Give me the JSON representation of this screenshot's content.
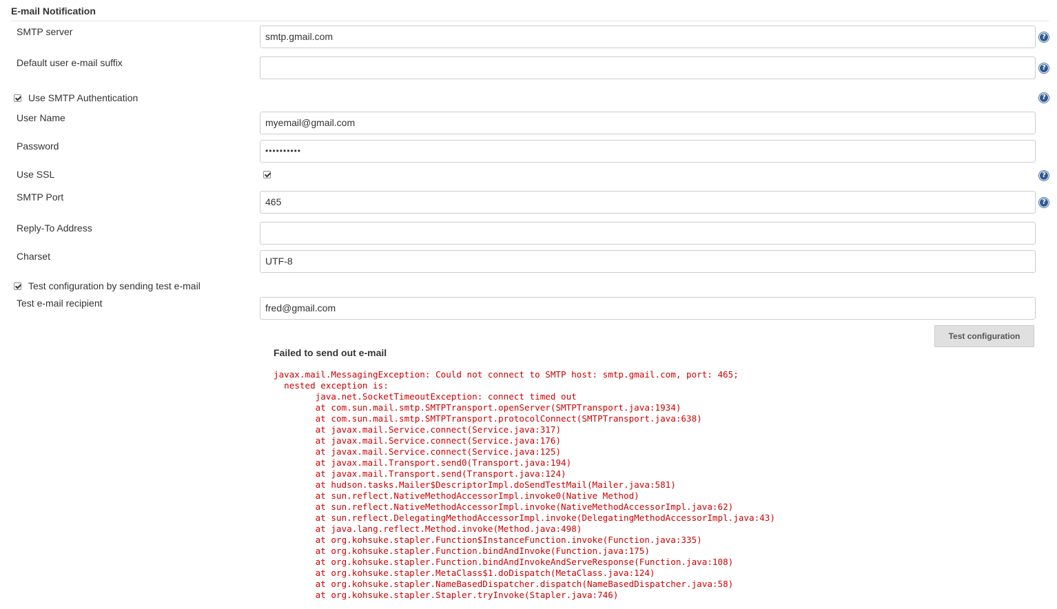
{
  "section": {
    "title": "E-mail Notification"
  },
  "fields": {
    "smtp_server": {
      "label": "SMTP server",
      "value": "smtp.gmail.com"
    },
    "email_suffix": {
      "label": "Default user e-mail suffix",
      "value": ""
    },
    "use_smtp_auth": {
      "label": "Use SMTP Authentication",
      "checked": true
    },
    "user_name": {
      "label": "User Name",
      "value": "myemail@gmail.com"
    },
    "password": {
      "label": "Password",
      "value": "••••••••••"
    },
    "use_ssl": {
      "label": "Use SSL",
      "checked": true
    },
    "smtp_port": {
      "label": "SMTP Port",
      "value": "465"
    },
    "reply_to": {
      "label": "Reply-To Address",
      "value": ""
    },
    "charset": {
      "label": "Charset",
      "value": "UTF-8"
    },
    "test_config": {
      "label": "Test configuration by sending test e-mail",
      "checked": true
    },
    "test_recipient": {
      "label": "Test e-mail recipient",
      "value": "fred@gmail.com"
    }
  },
  "help_icon": "?",
  "buttons": {
    "test_configuration": "Test configuration"
  },
  "error": {
    "title": "Failed to send out e-mail",
    "lines": [
      "javax.mail.MessagingException: Could not connect to SMTP host: smtp.gmail.com, port: 465;",
      "  nested exception is:",
      "\tjava.net.SocketTimeoutException: connect timed out",
      "\tat com.sun.mail.smtp.SMTPTransport.openServer(SMTPTransport.java:1934)",
      "\tat com.sun.mail.smtp.SMTPTransport.protocolConnect(SMTPTransport.java:638)",
      "\tat javax.mail.Service.connect(Service.java:317)",
      "\tat javax.mail.Service.connect(Service.java:176)",
      "\tat javax.mail.Service.connect(Service.java:125)",
      "\tat javax.mail.Transport.send0(Transport.java:194)",
      "\tat javax.mail.Transport.send(Transport.java:124)",
      "\tat hudson.tasks.Mailer$DescriptorImpl.doSendTestMail(Mailer.java:581)",
      "\tat sun.reflect.NativeMethodAccessorImpl.invoke0(Native Method)",
      "\tat sun.reflect.NativeMethodAccessorImpl.invoke(NativeMethodAccessorImpl.java:62)",
      "\tat sun.reflect.DelegatingMethodAccessorImpl.invoke(DelegatingMethodAccessorImpl.java:43)",
      "\tat java.lang.reflect.Method.invoke(Method.java:498)",
      "\tat org.kohsuke.stapler.Function$InstanceFunction.invoke(Function.java:335)",
      "\tat org.kohsuke.stapler.Function.bindAndInvoke(Function.java:175)",
      "\tat org.kohsuke.stapler.Function.bindAndInvokeAndServeResponse(Function.java:108)",
      "\tat org.kohsuke.stapler.MetaClass$1.doDispatch(MetaClass.java:124)",
      "\tat org.kohsuke.stapler.NameBasedDispatcher.dispatch(NameBasedDispatcher.java:58)",
      "\tat org.kohsuke.stapler.Stapler.tryInvoke(Stapler.java:746)"
    ]
  }
}
